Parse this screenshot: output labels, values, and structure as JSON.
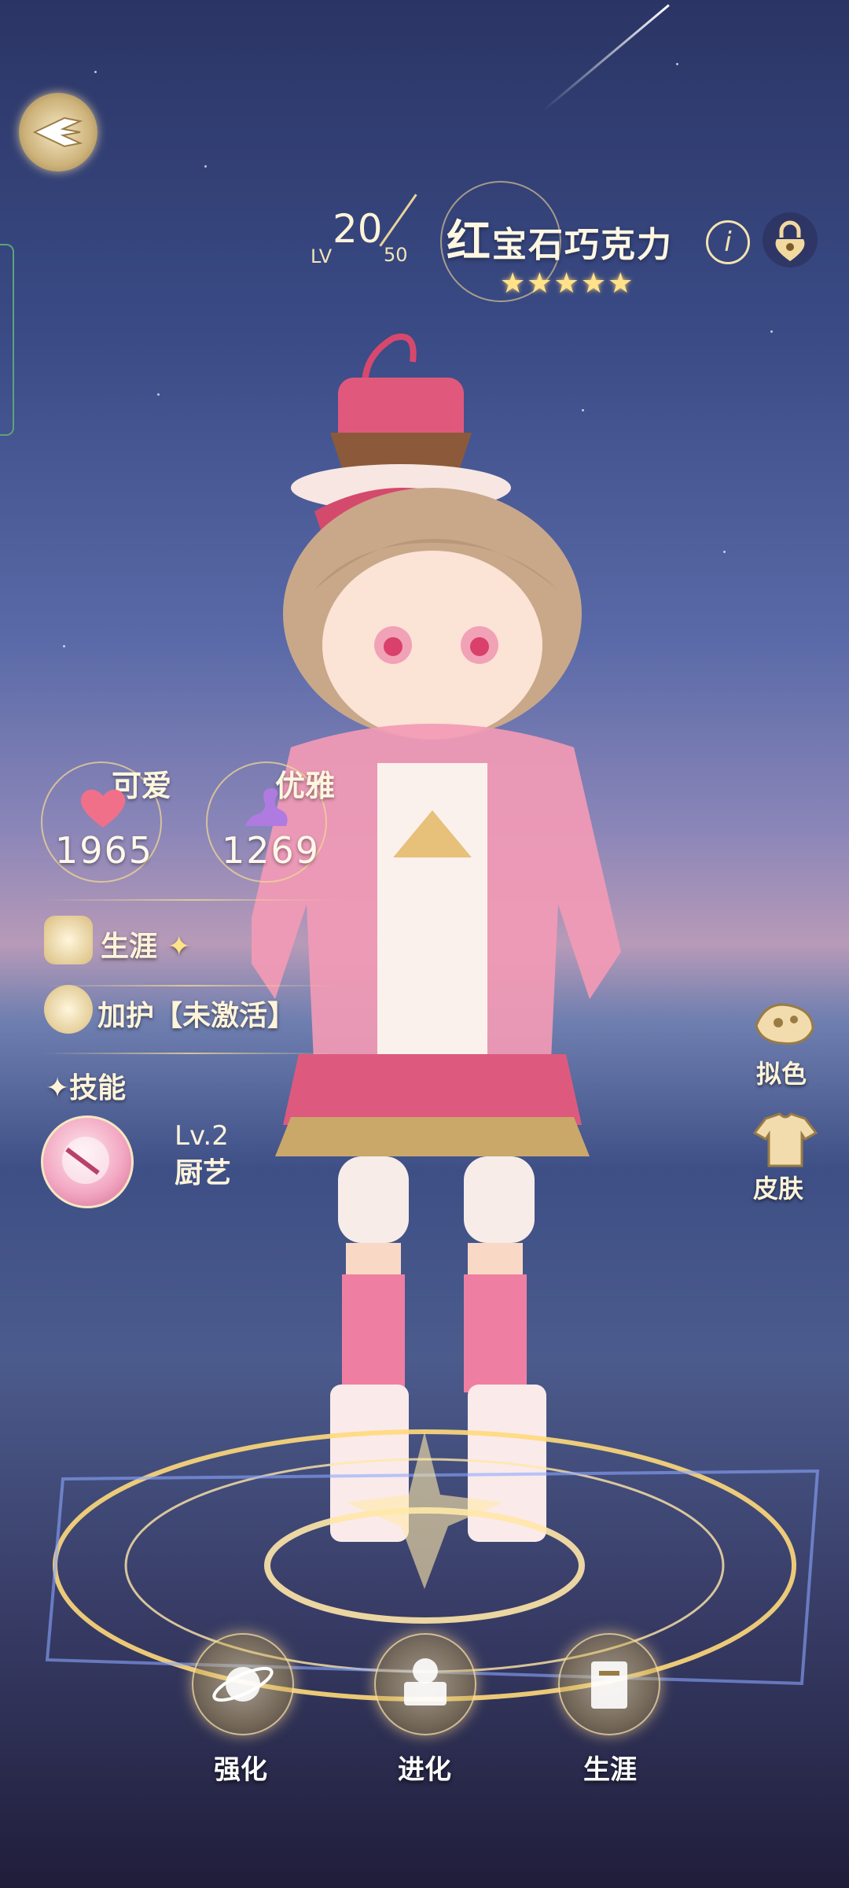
{
  "header": {
    "level_label": "LV",
    "level_current": "20",
    "level_max": "50",
    "name_first": "红",
    "name_rest": "宝石巧克力",
    "rarity_stars": "★★★★★",
    "info_icon": "info-icon",
    "lock_icon": "lock-icon"
  },
  "attributes": [
    {
      "label": "可爱",
      "value": "1965",
      "icon": "heart-icon",
      "color": "#f0708a"
    },
    {
      "label": "优雅",
      "value": "1269",
      "icon": "swan-icon",
      "color": "#b07be0"
    }
  ],
  "rows": {
    "career_label": "生涯",
    "career_stars": "✦",
    "guard_label": "加护",
    "guard_status": "【未激活】",
    "skill_label": "✦技能"
  },
  "skill": {
    "level": "Lv.2",
    "name": "厨艺"
  },
  "side_buttons": [
    {
      "label": "拟色",
      "icon": "dye-icon"
    },
    {
      "label": "皮肤",
      "icon": "skin-icon"
    }
  ],
  "bottom_nav": [
    {
      "label": "强化",
      "icon": "planet-icon"
    },
    {
      "label": "进化",
      "icon": "evolve-icon"
    },
    {
      "label": "生涯",
      "icon": "career-book-icon"
    }
  ],
  "colors": {
    "accent_gold": "#f0d696",
    "text_cream": "#fff4da"
  }
}
